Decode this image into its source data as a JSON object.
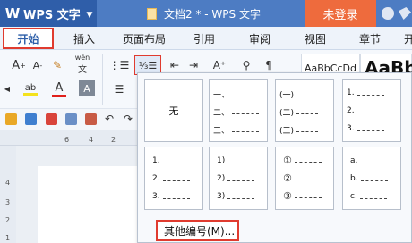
{
  "app": {
    "name": "WPS 文字",
    "logo": "W"
  },
  "window": {
    "title": "文档2 * - WPS 文字",
    "login_label": "未登录"
  },
  "tabs": [
    {
      "label": "开始"
    },
    {
      "label": "插入"
    },
    {
      "label": "页面布局"
    },
    {
      "label": "引用"
    },
    {
      "label": "审阅"
    },
    {
      "label": "视图"
    },
    {
      "label": "章节"
    },
    {
      "label": "开"
    }
  ],
  "ribbon": {
    "style_sample_1": "AaBbCcDd",
    "style_sample_2": "AaBb",
    "font_grow": "A",
    "font_shrink": "A",
    "font_color": "A",
    "highlight": "ab",
    "pinyin": "wén"
  },
  "ruler": {
    "h_marks": [
      "6",
      "4",
      "2"
    ],
    "v_marks": [
      "4",
      "3",
      "2",
      "1"
    ]
  },
  "numbering_menu": {
    "none_label": "无",
    "styles": [
      {
        "markers": [
          "一、",
          "二、",
          "三、"
        ]
      },
      {
        "markers": [
          "(一)",
          "(二)",
          "(三)"
        ]
      },
      {
        "markers": [
          "1.",
          "2.",
          "3."
        ]
      },
      {
        "markers": [
          "1.",
          "2.",
          "3."
        ]
      },
      {
        "markers": [
          "1)",
          "2)",
          "3)"
        ]
      },
      {
        "markers": [
          "①",
          "②",
          "③"
        ]
      },
      {
        "markers": [
          "a.",
          "b.",
          "c."
        ]
      }
    ],
    "more_label": "其他编号(M)..."
  }
}
